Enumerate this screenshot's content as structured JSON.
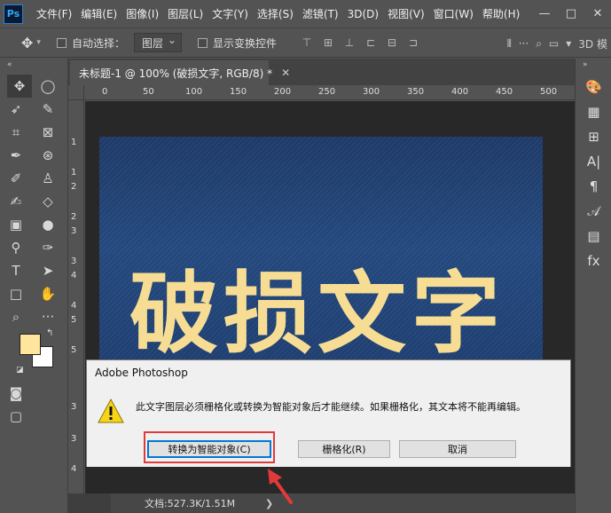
{
  "app": {
    "logo": "Ps",
    "menu": [
      "文件(F)",
      "编辑(E)",
      "图像(I)",
      "图层(L)",
      "文字(Y)",
      "选择(S)",
      "滤镜(T)",
      "3D(D)",
      "视图(V)",
      "窗口(W)",
      "帮助(H)"
    ],
    "window_controls": [
      "—",
      "□",
      "✕"
    ]
  },
  "options": {
    "auto_select_label": "自动选择：",
    "layer_select_value": "图层",
    "show_transform_label": "显示变换控件",
    "mode_3d_label": "3D 模"
  },
  "document": {
    "tab_title": "未标题-1 @ 100% (破损文字, RGB/8) *",
    "canvas_text": "破损文字",
    "status_text": "文档:527.3K/1.51M",
    "status_more": "❯",
    "ruler_h_labels": [
      "0",
      "50",
      "100",
      "150",
      "200",
      "250",
      "300",
      "350",
      "400",
      "450",
      "500"
    ],
    "ruler_v_labels": [
      "1",
      "1",
      "2",
      "2",
      "3",
      "3",
      "4",
      "4",
      "5",
      "5",
      "3",
      "3",
      "4"
    ]
  },
  "dialog": {
    "title": "Adobe Photoshop",
    "message": "此文字图层必须栅格化或转换为智能对象后才能继续。如果栅格化，其文本将不能再编辑。",
    "buttons": {
      "convert": "转换为智能对象(C)",
      "rasterize": "栅格化(R)",
      "cancel": "取消"
    }
  },
  "colors": {
    "foreground": "#ffe69c",
    "background": "#ffffff",
    "highlight": "#e23a3a"
  }
}
